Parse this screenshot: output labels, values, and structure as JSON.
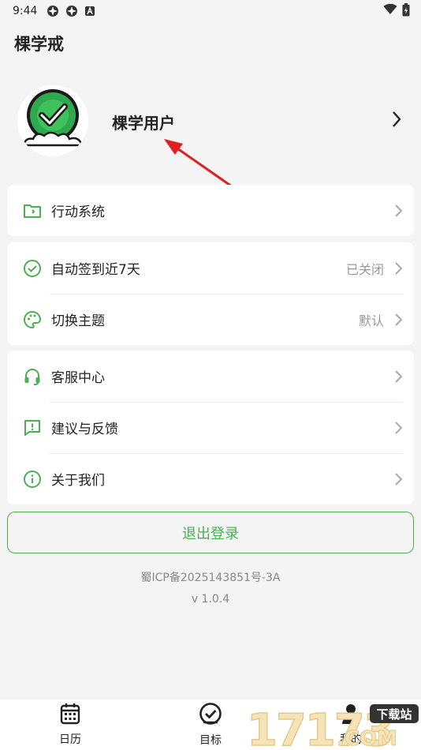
{
  "status_bar": {
    "time": "9:44"
  },
  "app": {
    "title": "棵学戒"
  },
  "profile": {
    "username": "棵学用户"
  },
  "cards": [
    {
      "items": [
        {
          "label": "行动系统",
          "icon": "folder-icon",
          "value": ""
        }
      ]
    },
    {
      "items": [
        {
          "label": "自动签到近7天",
          "icon": "check-circle-icon",
          "value": "已关闭"
        },
        {
          "label": "切换主题",
          "icon": "palette-icon",
          "value": "默认"
        }
      ]
    },
    {
      "items": [
        {
          "label": "客服中心",
          "icon": "headset-icon",
          "value": ""
        },
        {
          "label": "建议与反馈",
          "icon": "feedback-icon",
          "value": ""
        },
        {
          "label": "关于我们",
          "icon": "info-icon",
          "value": ""
        }
      ]
    }
  ],
  "logout": {
    "label": "退出登录"
  },
  "footer": {
    "icp": "蜀ICP备2025143851号-3A",
    "version": "v 1.0.4"
  },
  "bottom_nav": [
    {
      "label": "日历",
      "icon": "calendar-icon"
    },
    {
      "label": "目标",
      "icon": "target-check-icon"
    },
    {
      "label": "我的",
      "icon": "person-icon"
    }
  ],
  "watermark": {
    "text": "17173",
    "badge": "下载站",
    "domain": ".COM"
  },
  "colors": {
    "accent": "#4caf50",
    "background": "#f4f4f4",
    "annotation": "#e02020"
  }
}
